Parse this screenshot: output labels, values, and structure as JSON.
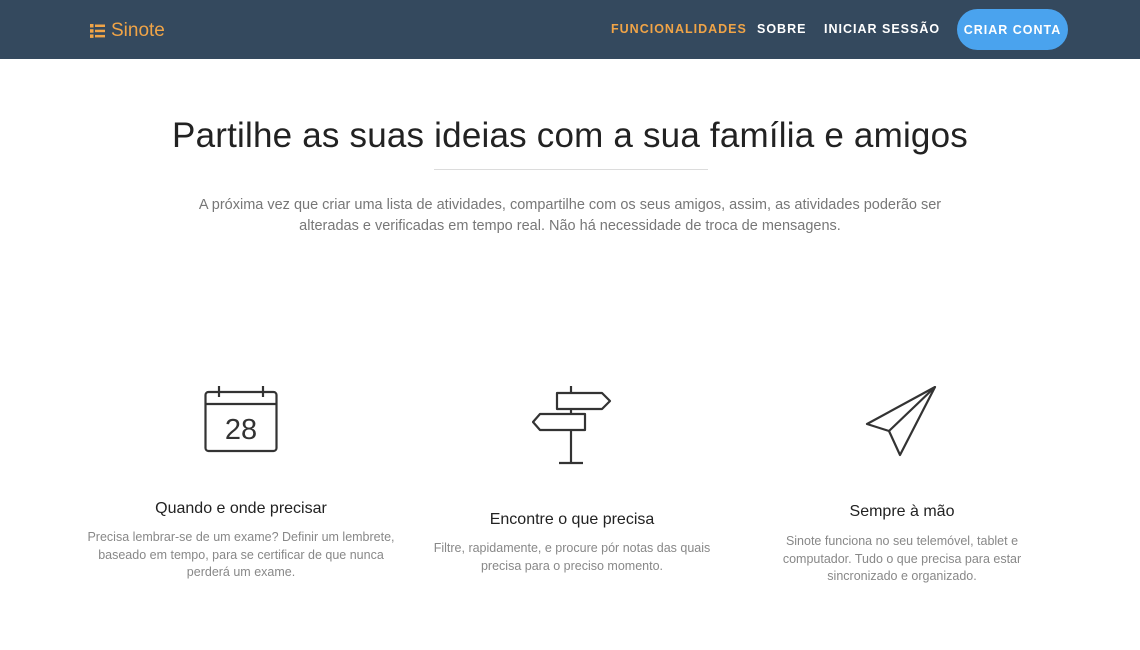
{
  "brand": {
    "name": "Sinote",
    "icon": "list-icon",
    "color": "#f0a447"
  },
  "nav": {
    "links": [
      {
        "label": "FUNCIONALIDADES",
        "active": true
      },
      {
        "label": "SOBRE",
        "active": false
      },
      {
        "label": "INICIAR SESSÃO",
        "active": false
      }
    ],
    "cta": "CRIAR CONTA"
  },
  "hero": {
    "title": "Partilhe as suas ideias com a sua família e amigos",
    "text": "A próxima vez que criar uma lista de atividades, compartilhe com os seus amigos, assim, as atividades poderão ser alteradas e verificadas em tempo real. Não há necessidade de troca de mensagens."
  },
  "features": [
    {
      "icon": "calendar-icon",
      "calendar_day": "28",
      "title": "Quando e onde precisar",
      "text": "Precisa lembrar-se de um exame? Definir um lembrete, baseado em tempo, para se certificar de que nunca perderá um exame."
    },
    {
      "icon": "signpost-icon",
      "title": "Encontre o que precisa",
      "text": "Filtre, rapidamente, e procure pór notas das quais precisa para o preciso momento."
    },
    {
      "icon": "paper-plane-icon",
      "title": "Sempre à mão",
      "text": "Sinote funciona no seu telemóvel, tablet e computador. Tudo o que precisa para estar sincronizado e organizado."
    }
  ],
  "colors": {
    "navbar": "#34495e",
    "accent": "#f0a447",
    "cta": "#4aa3ee"
  }
}
